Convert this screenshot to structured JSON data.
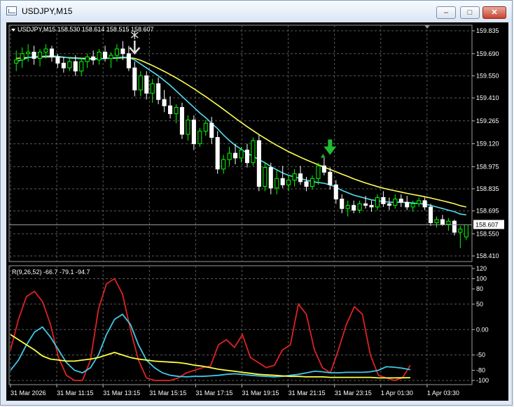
{
  "window": {
    "title": "USDJPY,M15",
    "buttons": {
      "minimize": "–",
      "maximize": "□",
      "close": "✕"
    }
  },
  "chart_data": [
    {
      "type": "candlestick",
      "header": "USDJPY,M15  158.530 158.614 158.515 158.607",
      "price_labels": [
        "159.835",
        "159.690",
        "159.550",
        "159.410",
        "159.265",
        "159.120",
        "158.975",
        "158.835",
        "158.695",
        "158.550",
        "158.410"
      ],
      "current_price": "158.607",
      "ylim": [
        158.41,
        159.835
      ],
      "grid": true,
      "colors": {
        "background": "#000000",
        "bull": "#00ff00",
        "bear": "#ffffff",
        "grid": "#5a5a5a",
        "ma_fast": "#55ddee",
        "ma_slow": "#ffff55"
      },
      "candles": [
        [
          159.63,
          159.71,
          159.58,
          159.65
        ],
        [
          159.65,
          159.73,
          159.6,
          159.69
        ],
        [
          159.69,
          159.75,
          159.64,
          159.7
        ],
        [
          159.7,
          159.74,
          159.62,
          159.66
        ],
        [
          159.66,
          159.72,
          159.61,
          159.7
        ],
        [
          159.7,
          159.75,
          159.66,
          159.72
        ],
        [
          159.72,
          159.74,
          159.64,
          159.67
        ],
        [
          159.67,
          159.69,
          159.6,
          159.63
        ],
        [
          159.63,
          159.67,
          159.57,
          159.6
        ],
        [
          159.6,
          159.66,
          159.58,
          159.64
        ],
        [
          159.64,
          159.68,
          159.55,
          159.58
        ],
        [
          159.58,
          159.66,
          159.55,
          159.64
        ],
        [
          159.64,
          159.69,
          159.6,
          159.67
        ],
        [
          159.67,
          159.71,
          159.62,
          159.65
        ],
        [
          159.65,
          159.72,
          159.62,
          159.7
        ],
        [
          159.7,
          159.74,
          159.64,
          159.66
        ],
        [
          159.66,
          159.7,
          159.6,
          159.68
        ],
        [
          159.68,
          159.75,
          159.64,
          159.72
        ],
        [
          159.72,
          159.77,
          159.65,
          159.69
        ],
        [
          159.69,
          159.74,
          159.58,
          159.6
        ],
        [
          159.6,
          159.64,
          159.42,
          159.46
        ],
        [
          159.46,
          159.58,
          159.42,
          159.55
        ],
        [
          159.55,
          159.58,
          159.4,
          159.44
        ],
        [
          159.44,
          159.53,
          159.38,
          159.5
        ],
        [
          159.5,
          159.54,
          159.37,
          159.4
        ],
        [
          159.4,
          159.46,
          159.32,
          159.36
        ],
        [
          159.36,
          159.42,
          159.28,
          159.31
        ],
        [
          159.31,
          159.37,
          159.25,
          159.35
        ],
        [
          159.35,
          159.38,
          159.15,
          159.18
        ],
        [
          159.18,
          159.3,
          159.14,
          159.27
        ],
        [
          159.27,
          159.3,
          159.08,
          159.12
        ],
        [
          159.12,
          159.22,
          159.1,
          159.2
        ],
        [
          159.2,
          159.27,
          159.17,
          159.25
        ],
        [
          159.25,
          159.29,
          159.12,
          159.16
        ],
        [
          159.16,
          159.2,
          158.93,
          158.96
        ],
        [
          158.96,
          159.05,
          158.93,
          159.02
        ],
        [
          159.02,
          159.1,
          158.98,
          159.06
        ],
        [
          159.06,
          159.12,
          158.99,
          159.03
        ],
        [
          159.03,
          159.1,
          159.0,
          159.08
        ],
        [
          159.08,
          159.12,
          158.97,
          159.0
        ],
        [
          159.0,
          159.16,
          158.98,
          159.14
        ],
        [
          159.14,
          159.18,
          158.82,
          158.85
        ],
        [
          158.85,
          159.0,
          158.82,
          158.97
        ],
        [
          158.97,
          159.0,
          158.8,
          158.84
        ],
        [
          158.84,
          158.95,
          158.8,
          158.9
        ],
        [
          158.9,
          158.98,
          158.84,
          158.86
        ],
        [
          158.86,
          158.92,
          158.82,
          158.89
        ],
        [
          158.89,
          158.96,
          158.85,
          158.93
        ],
        [
          158.93,
          158.98,
          158.86,
          158.88
        ],
        [
          158.88,
          158.91,
          158.82,
          158.85
        ],
        [
          158.85,
          158.92,
          158.83,
          158.9
        ],
        [
          158.9,
          159.0,
          158.86,
          158.98
        ],
        [
          158.98,
          159.03,
          158.92,
          158.94
        ],
        [
          158.94,
          158.97,
          158.83,
          158.86
        ],
        [
          158.86,
          158.89,
          158.74,
          158.77
        ],
        [
          158.77,
          158.8,
          158.68,
          158.71
        ],
        [
          158.71,
          158.76,
          158.66,
          158.73
        ],
        [
          158.73,
          158.76,
          158.68,
          158.7
        ],
        [
          158.7,
          158.76,
          158.68,
          158.74
        ],
        [
          158.74,
          158.79,
          158.71,
          158.73
        ],
        [
          158.73,
          158.76,
          158.69,
          158.72
        ],
        [
          158.72,
          158.8,
          158.7,
          158.78
        ],
        [
          158.78,
          158.82,
          158.72,
          158.74
        ],
        [
          158.74,
          158.78,
          158.7,
          158.73
        ],
        [
          158.73,
          158.8,
          158.71,
          158.77
        ],
        [
          158.77,
          158.8,
          158.72,
          158.75
        ],
        [
          158.75,
          158.79,
          158.7,
          158.72
        ],
        [
          158.72,
          158.76,
          158.69,
          158.74
        ],
        [
          158.74,
          158.78,
          158.72,
          158.76
        ],
        [
          158.76,
          158.78,
          158.7,
          158.72
        ],
        [
          158.72,
          158.74,
          158.6,
          158.62
        ],
        [
          158.62,
          158.66,
          158.59,
          158.64
        ],
        [
          158.64,
          158.67,
          158.6,
          158.61
        ],
        [
          158.61,
          158.65,
          158.57,
          158.63
        ],
        [
          158.63,
          158.64,
          158.54,
          158.56
        ],
        [
          158.56,
          158.6,
          158.46,
          158.58
        ],
        [
          158.53,
          158.61,
          158.51,
          158.607
        ]
      ],
      "ma_fast": [
        159.64,
        159.652,
        159.665,
        159.67,
        159.672,
        159.675,
        159.676,
        159.673,
        159.668,
        159.663,
        159.66,
        159.658,
        159.655,
        159.656,
        159.658,
        159.66,
        159.662,
        159.665,
        159.668,
        159.666,
        159.65,
        159.625,
        159.6,
        159.575,
        159.55,
        159.52,
        159.49,
        159.455,
        159.42,
        159.385,
        159.35,
        159.315,
        159.285,
        159.25,
        159.215,
        159.175,
        159.14,
        159.11,
        159.085,
        159.06,
        159.04,
        159.02,
        159.0,
        158.975,
        158.955,
        158.935,
        158.92,
        158.91,
        158.9,
        158.89,
        158.88,
        158.875,
        158.87,
        158.86,
        158.845,
        158.825,
        158.81,
        158.795,
        158.785,
        158.775,
        158.765,
        158.76,
        158.755,
        158.75,
        158.75,
        158.75,
        158.748,
        158.745,
        158.742,
        158.738,
        158.73,
        158.72,
        158.71,
        158.7,
        158.69,
        158.675,
        158.67
      ],
      "ma_slow": [
        159.66,
        159.663,
        159.666,
        159.668,
        159.669,
        159.67,
        159.67,
        159.669,
        159.667,
        159.665,
        159.663,
        159.661,
        159.66,
        159.659,
        159.659,
        159.66,
        159.661,
        159.662,
        159.664,
        159.664,
        159.66,
        159.648,
        159.632,
        159.615,
        159.597,
        159.578,
        159.558,
        159.537,
        159.515,
        159.492,
        159.468,
        159.443,
        159.418,
        159.392,
        159.365,
        159.338,
        159.31,
        159.282,
        159.255,
        159.228,
        159.203,
        159.178,
        159.155,
        159.132,
        159.11,
        159.09,
        159.07,
        159.052,
        159.035,
        159.018,
        159.002,
        158.987,
        158.972,
        158.958,
        158.943,
        158.928,
        158.913,
        158.898,
        158.885,
        158.872,
        158.86,
        158.849,
        158.839,
        158.83,
        158.822,
        158.814,
        158.806,
        158.799,
        158.792,
        158.785,
        158.777,
        158.768,
        158.759,
        158.75,
        158.74,
        158.728,
        158.72
      ],
      "markers": [
        {
          "type": "sell-arrow",
          "candle": 20,
          "color": "#e0e0e0"
        },
        {
          "type": "buy-arrow",
          "candle": 53,
          "color": "#22bb33"
        }
      ]
    },
    {
      "type": "line",
      "header": "R(9,26,52) -66.7 -79.1 -94.7",
      "ylim": [
        -100,
        120
      ],
      "yticks": [
        "120",
        "100",
        "80",
        "50",
        "0.00",
        "-50",
        "-80",
        "-100"
      ],
      "ytick_values": [
        120,
        100,
        80,
        50,
        0,
        -50,
        -80,
        -100
      ],
      "x_labels": [
        "31 Mar 2026",
        "31 Mar 11:15",
        "31 Mar 13:15",
        "31 Mar 15:15",
        "31 Mar 17:15",
        "31 Mar 19:15",
        "31 Mar 21:15",
        "31 Mar 23:15",
        "1 Apr 01:30",
        "1 Apr 03:30"
      ],
      "series": [
        {
          "color": "#dd2222",
          "values": [
            -40,
            20,
            65,
            75,
            55,
            10,
            -55,
            -90,
            -100,
            -100,
            -60,
            40,
            90,
            100,
            70,
            0,
            -60,
            -95,
            -100,
            -100,
            -100,
            -95,
            -85,
            -80,
            -75,
            -72,
            -30,
            -20,
            -35,
            -10,
            -55,
            -65,
            -75,
            -70,
            -40,
            -30,
            50,
            30,
            -40,
            -75,
            -85,
            -40,
            10,
            45,
            30,
            -50,
            -90,
            -95,
            -100,
            -95,
            -70
          ]
        },
        {
          "color": "#3fc9e6",
          "values": [
            -80,
            -60,
            -30,
            -5,
            5,
            -15,
            -40,
            -65,
            -80,
            -85,
            -75,
            -50,
            -10,
            20,
            30,
            10,
            -30,
            -60,
            -75,
            -85,
            -90,
            -92,
            -93,
            -92,
            -92,
            -91,
            -90,
            -88,
            -87,
            -88,
            -90,
            -91,
            -92,
            -93,
            -92,
            -90,
            -88,
            -85,
            -82,
            -83,
            -85,
            -85,
            -84,
            -84,
            -84,
            -83,
            -80,
            -73,
            -74,
            -76,
            -79.1
          ]
        },
        {
          "color": "#ffff44",
          "values": [
            -10,
            -20,
            -30,
            -40,
            -52,
            -58,
            -60,
            -62,
            -62,
            -60,
            -58,
            -55,
            -50,
            -45,
            -50,
            -55,
            -58,
            -60,
            -62,
            -63,
            -64,
            -65,
            -67,
            -70,
            -72,
            -75,
            -78,
            -80,
            -82,
            -84,
            -86,
            -88,
            -89,
            -90,
            -91,
            -92,
            -92,
            -93,
            -93,
            -93,
            -94,
            -94,
            -94,
            -94,
            -94,
            -94,
            -95,
            -95,
            -95,
            -94.8,
            -94.7
          ]
        }
      ]
    }
  ]
}
